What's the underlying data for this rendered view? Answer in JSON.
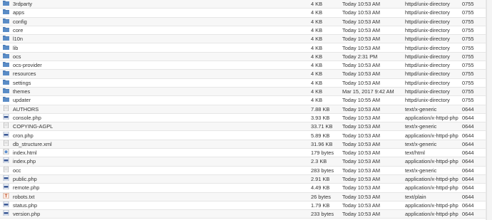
{
  "files": [
    {
      "name": "3rdparty",
      "size": "4 KB",
      "modified": "Today 10:53 AM",
      "mime": "httpd/unix-directory",
      "perms": "0755",
      "icon": "folder-icon"
    },
    {
      "name": "apps",
      "size": "4 KB",
      "modified": "Today 10:53 AM",
      "mime": "httpd/unix-directory",
      "perms": "0755",
      "icon": "folder-icon"
    },
    {
      "name": "config",
      "size": "4 KB",
      "modified": "Today 10:53 AM",
      "mime": "httpd/unix-directory",
      "perms": "0755",
      "icon": "folder-icon"
    },
    {
      "name": "core",
      "size": "4 KB",
      "modified": "Today 10:53 AM",
      "mime": "httpd/unix-directory",
      "perms": "0755",
      "icon": "folder-icon"
    },
    {
      "name": "l10n",
      "size": "4 KB",
      "modified": "Today 10:53 AM",
      "mime": "httpd/unix-directory",
      "perms": "0755",
      "icon": "folder-icon"
    },
    {
      "name": "lib",
      "size": "4 KB",
      "modified": "Today 10:53 AM",
      "mime": "httpd/unix-directory",
      "perms": "0755",
      "icon": "folder-icon"
    },
    {
      "name": "ocs",
      "size": "4 KB",
      "modified": "Today 2:31 PM",
      "mime": "httpd/unix-directory",
      "perms": "0755",
      "icon": "folder-icon"
    },
    {
      "name": "ocs-provider",
      "size": "4 KB",
      "modified": "Today 10:53 AM",
      "mime": "httpd/unix-directory",
      "perms": "0755",
      "icon": "folder-icon"
    },
    {
      "name": "resources",
      "size": "4 KB",
      "modified": "Today 10:53 AM",
      "mime": "httpd/unix-directory",
      "perms": "0755",
      "icon": "folder-icon"
    },
    {
      "name": "settings",
      "size": "4 KB",
      "modified": "Today 10:53 AM",
      "mime": "httpd/unix-directory",
      "perms": "0755",
      "icon": "folder-icon"
    },
    {
      "name": "themes",
      "size": "4 KB",
      "modified": "Mar 15, 2017 9:42 AM",
      "mime": "httpd/unix-directory",
      "perms": "0755",
      "icon": "folder-icon"
    },
    {
      "name": "updater",
      "size": "4 KB",
      "modified": "Today 10:55 AM",
      "mime": "httpd/unix-directory",
      "perms": "0755",
      "icon": "folder-icon"
    },
    {
      "name": "AUTHORS",
      "size": "7.88 KB",
      "modified": "Today 10:53 AM",
      "mime": "text/x-generic",
      "perms": "0644",
      "icon": "text-file-icon"
    },
    {
      "name": "console.php",
      "size": "3.93 KB",
      "modified": "Today 10:53 AM",
      "mime": "application/x-httpd-php",
      "perms": "0644",
      "icon": "php-file-icon"
    },
    {
      "name": "COPYING-AGPL",
      "size": "33.71 KB",
      "modified": "Today 10:53 AM",
      "mime": "text/x-generic",
      "perms": "0644",
      "icon": "text-file-icon"
    },
    {
      "name": "cron.php",
      "size": "5.89 KB",
      "modified": "Today 10:53 AM",
      "mime": "application/x-httpd-php",
      "perms": "0644",
      "icon": "php-file-icon"
    },
    {
      "name": "db_structure.xml",
      "size": "31.96 KB",
      "modified": "Today 10:53 AM",
      "mime": "text/x-generic",
      "perms": "0644",
      "icon": "text-file-icon"
    },
    {
      "name": "index.html",
      "size": "179 bytes",
      "modified": "Today 10:53 AM",
      "mime": "text/html",
      "perms": "0644",
      "icon": "html-file-icon"
    },
    {
      "name": "index.php",
      "size": "2.3 KB",
      "modified": "Today 10:53 AM",
      "mime": "application/x-httpd-php",
      "perms": "0644",
      "icon": "php-file-icon"
    },
    {
      "name": "occ",
      "size": "283 bytes",
      "modified": "Today 10:53 AM",
      "mime": "text/x-generic",
      "perms": "0644",
      "icon": "text-file-icon"
    },
    {
      "name": "public.php",
      "size": "2.91 KB",
      "modified": "Today 10:53 AM",
      "mime": "application/x-httpd-php",
      "perms": "0644",
      "icon": "php-file-icon"
    },
    {
      "name": "remote.php",
      "size": "4.49 KB",
      "modified": "Today 10:53 AM",
      "mime": "application/x-httpd-php",
      "perms": "0644",
      "icon": "php-file-icon"
    },
    {
      "name": "robots.txt",
      "size": "26 bytes",
      "modified": "Today 10:53 AM",
      "mime": "text/plain",
      "perms": "0644",
      "icon": "plain-text-file-icon"
    },
    {
      "name": "status.php",
      "size": "1.79 KB",
      "modified": "Today 10:53 AM",
      "mime": "application/x-httpd-php",
      "perms": "0644",
      "icon": "php-file-icon"
    },
    {
      "name": "version.php",
      "size": "233 bytes",
      "modified": "Today 10:53 AM",
      "mime": "application/x-httpd-php",
      "perms": "0644",
      "icon": "php-file-icon"
    }
  ],
  "colors": {
    "folder": "#4a7ab5",
    "row_alt": "#f7f7f7",
    "text": "#333333"
  }
}
